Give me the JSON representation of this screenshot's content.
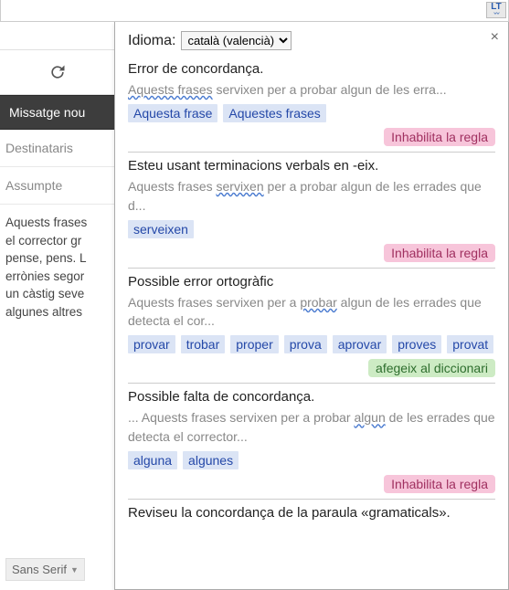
{
  "topbar": {
    "badge": "LT"
  },
  "left": {
    "compose": "Missatge nou",
    "recipients": "Destinataris",
    "subject": "Assumpte",
    "paragraph_lines": [
      "Aquests frases",
      "el corrector gr",
      "pense, pens. L",
      "errònies segor",
      "un càstig seve",
      "algunes altres"
    ],
    "font_picker": "Sans Serif"
  },
  "popup": {
    "lang_label": "Idioma:",
    "lang_value": "català (valencià)",
    "issues": [
      {
        "title": "Error de concordança.",
        "ctx_pre": "",
        "ctx_wave": "Aquests frases",
        "ctx_post": " servixen per a probar algun de les erra...",
        "suggestions": [
          "Aquesta frase",
          "Aquestes frases"
        ],
        "action_label": "Inhabilita la regla",
        "action_kind": "pink"
      },
      {
        "title": "Esteu usant terminacions verbals en -eix.",
        "ctx_pre": "Aquests frases ",
        "ctx_wave": "servixen",
        "ctx_post": " per a probar algun de les errades que d...",
        "suggestions": [
          "serveixen"
        ],
        "action_label": "Inhabilita la regla",
        "action_kind": "pink"
      },
      {
        "title": "Possible error ortogràfic",
        "ctx_pre": "Aquests frases servixen per a ",
        "ctx_wave": "probar",
        "ctx_post": " algun de les errades que detecta el cor...",
        "suggestions": [
          "provar",
          "trobar",
          "proper",
          "prova",
          "aprovar",
          "proves",
          "provat"
        ],
        "action_label": "afegeix al diccionari",
        "action_kind": "green"
      },
      {
        "title": "Possible falta de concordança.",
        "ctx_pre": "... Aquests frases servixen per a probar ",
        "ctx_wave": "algun",
        "ctx_post": " de les errades que detecta el corrector...",
        "suggestions": [
          "alguna",
          "algunes"
        ],
        "action_label": "Inhabilita la regla",
        "action_kind": "pink"
      },
      {
        "title": "Reviseu la concordança de la paraula «gramaticals».",
        "ctx_pre": "",
        "ctx_wave": "",
        "ctx_post": "",
        "suggestions": [],
        "action_label": "",
        "action_kind": ""
      }
    ]
  }
}
